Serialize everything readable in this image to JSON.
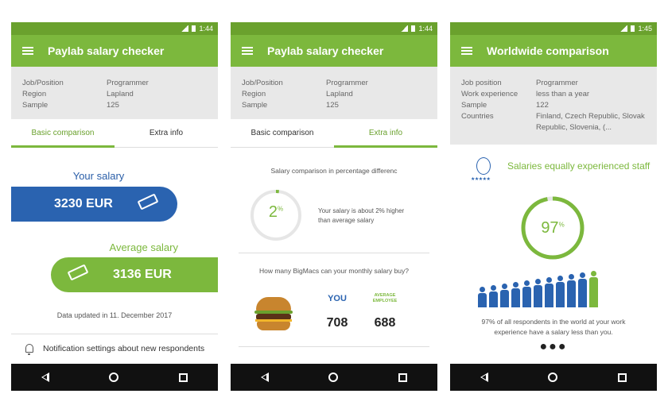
{
  "screens": [
    {
      "status_time": "1:44",
      "title": "Paylab salary checker",
      "info": [
        {
          "key": "Job/Position",
          "value": "Programmer"
        },
        {
          "key": "Region",
          "value": "Lapland"
        },
        {
          "key": "Sample",
          "value": "125"
        }
      ],
      "tabs": [
        "Basic comparison",
        "Extra info"
      ],
      "active_tab": 0,
      "your_salary_label": "Your salary",
      "your_salary_value": "3230 EUR",
      "average_salary_label": "Average salary",
      "average_salary_value": "3136 EUR",
      "updated": "Data updated in 11. December 2017",
      "notification": "Notification settings about new respondents"
    },
    {
      "status_time": "1:44",
      "title": "Paylab salary checker",
      "info": [
        {
          "key": "Job/Position",
          "value": "Programmer"
        },
        {
          "key": "Region",
          "value": "Lapland"
        },
        {
          "key": "Sample",
          "value": "125"
        }
      ],
      "tabs": [
        "Basic comparison",
        "Extra info"
      ],
      "active_tab": 1,
      "percent_title": "Salary comparison in percentage differenc",
      "percent_value": "2",
      "percent_sign": "%",
      "percent_fraction": 0.02,
      "percent_desc": "Your salary is about 2% higher than average salary",
      "bigmac_title": "How many BigMacs can your monthly salary buy?",
      "you_label": "YOU",
      "avg_employee_label": "AVERAGE EMPLOYEE",
      "you_value": "708",
      "avg_employee_value": "688"
    },
    {
      "status_time": "1:45",
      "title": "Worldwide comparison",
      "info": [
        {
          "key": "Job position",
          "value": "Programmer"
        },
        {
          "key": "Work experience",
          "value": "less than a year"
        },
        {
          "key": "Sample",
          "value": "122"
        },
        {
          "key": "Countries",
          "value": "Finland, Czech Republic, Slovak Republic, Slovenia, (..."
        }
      ],
      "stars": "★★★★★",
      "exp_title": "Salaries equally experienced staff",
      "big_percent_value": "97",
      "big_percent_sign": "%",
      "big_percent_fraction": 0.97,
      "people_count": 11,
      "exp_desc": "97% of all respondents in the world at your work experience have a salary less than you.",
      "more_dots": "●●●"
    }
  ],
  "colors": {
    "green": "#7cb83d",
    "dark_green": "#6aa12d",
    "blue": "#2a63b0",
    "ring_track": "#e6e6e6"
  },
  "icons": [
    "menu-icon",
    "signal-icon",
    "battery-icon",
    "money-icon",
    "bell-icon",
    "burger-icon",
    "person-icon",
    "back-icon",
    "home-icon",
    "recent-apps-icon"
  ]
}
